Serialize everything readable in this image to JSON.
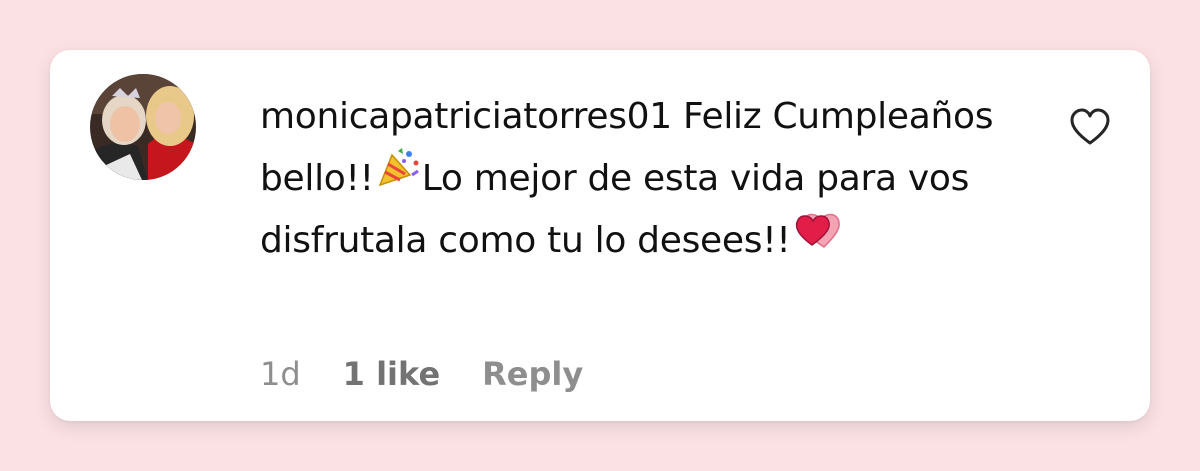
{
  "comment": {
    "username": "monicapatriciatorres01",
    "text_part1": " Feliz Cumpleaños bello!!",
    "emoji1": "party-popper",
    "text_part2": "Lo mejor de esta vida para vos disfrutala como tu lo desees!!",
    "emoji2": "two-hearts"
  },
  "meta": {
    "time": "1d",
    "likes": "1 like",
    "reply": "Reply"
  },
  "colors": {
    "page_background": "#fbe1e3",
    "card_background": "#ffffff",
    "text": "#111111",
    "meta_text": "#8e8e8e"
  },
  "icons": {
    "like": "heart-outline-icon",
    "avatar": "profile-photo"
  }
}
